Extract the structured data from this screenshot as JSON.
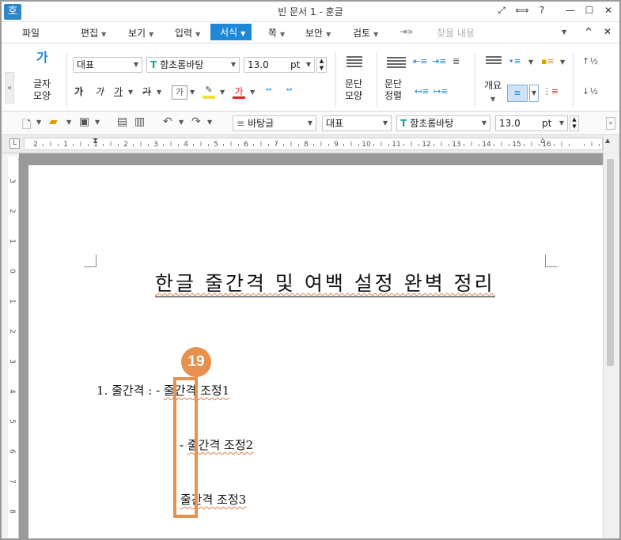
{
  "window": {
    "app_icon": "호",
    "title": "빈 문서 1 - 훈글",
    "controls": [
      "⤢",
      "⟺",
      "?",
      "—",
      "☐",
      "✕"
    ]
  },
  "menu": {
    "items": [
      {
        "label": "파일",
        "arrow": false
      },
      {
        "label": "편집",
        "arrow": true
      },
      {
        "label": "보기",
        "arrow": true
      },
      {
        "label": "입력",
        "arrow": true
      },
      {
        "label": "서식",
        "arrow": true,
        "active": true
      },
      {
        "label": "쪽",
        "arrow": true
      },
      {
        "label": "보안",
        "arrow": true
      },
      {
        "label": "검토",
        "arrow": true
      }
    ],
    "search_placeholder": "찾을 내용",
    "collapse_icon": "^",
    "close_icon": "✕"
  },
  "ribbon": {
    "char_shape_label": "글자\n모양",
    "style_value": "대표",
    "font_value": "함초롬바탕",
    "size_value": "13.0",
    "size_unit": "pt",
    "para_shape_label": "문단\n모양",
    "para_align_label": "문단\n정렬",
    "outline_label": "개요",
    "char_buttons": [
      "가",
      "가",
      "가",
      "가"
    ],
    "expand_left": "«"
  },
  "toolbar": {
    "style_value": "바탕글",
    "style2_value": "대표",
    "font_value": "함초롬바탕",
    "size_value": "13.0",
    "size_unit": "pt"
  },
  "ruler": {
    "numbers": [
      "2",
      "1",
      "1",
      "2",
      "3",
      "4",
      "5",
      "6",
      "7",
      "8",
      "9",
      "10",
      "11",
      "12",
      "13",
      "14",
      "15",
      "16"
    ]
  },
  "vruler": {
    "numbers": [
      "3",
      "2",
      "1",
      "0",
      "1",
      "2",
      "3",
      "4",
      "5",
      "6",
      "7",
      "8"
    ]
  },
  "document": {
    "title": "한글  줄간격  및  여백  설정  완벽  정리",
    "line1_prefix": "1.  줄간격  :  -",
    "line1_text": "줄간격  조정1",
    "line2_prefix": "-",
    "line2_text": "줄간격  조정2",
    "line3_prefix": "-",
    "line3_text": "줄간격  조정3"
  },
  "annotation": {
    "badge": "19",
    "color": "#e8904e"
  },
  "colors": {
    "accent": "#1f88d6",
    "page": "#ffffff",
    "workspace": "#9a9a9a"
  }
}
